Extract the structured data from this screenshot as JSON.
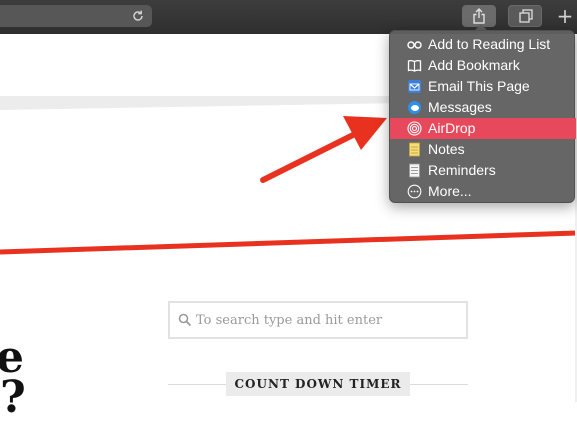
{
  "toolbar": {
    "reload_icon": "reload-icon",
    "share_icon": "share-icon",
    "tabs_icon": "tabs-overview-icon",
    "new_tab_label": "+"
  },
  "share_menu": {
    "items": [
      {
        "label": "Add to Reading List",
        "icon": "reading-list-icon"
      },
      {
        "label": "Add Bookmark",
        "icon": "bookmark-book-icon"
      },
      {
        "label": "Email This Page",
        "icon": "mail-icon"
      },
      {
        "label": "Messages",
        "icon": "messages-icon"
      },
      {
        "label": "AirDrop",
        "icon": "airdrop-icon",
        "highlighted": true
      },
      {
        "label": "Notes",
        "icon": "notes-icon"
      },
      {
        "label": "Reminders",
        "icon": "reminders-icon"
      },
      {
        "label": "More...",
        "icon": "more-icon"
      }
    ],
    "highlight_color": "#e8485c"
  },
  "page": {
    "search": {
      "placeholder": "To search type and hit enter",
      "value": ""
    },
    "widget_title": "COUNT DOWN TIMER",
    "heading_fragment_1": "e",
    "heading_fragment_2": "?"
  },
  "annotation": {
    "arrow_color": "#e8321f",
    "accent_line_color": "#e8321f"
  }
}
